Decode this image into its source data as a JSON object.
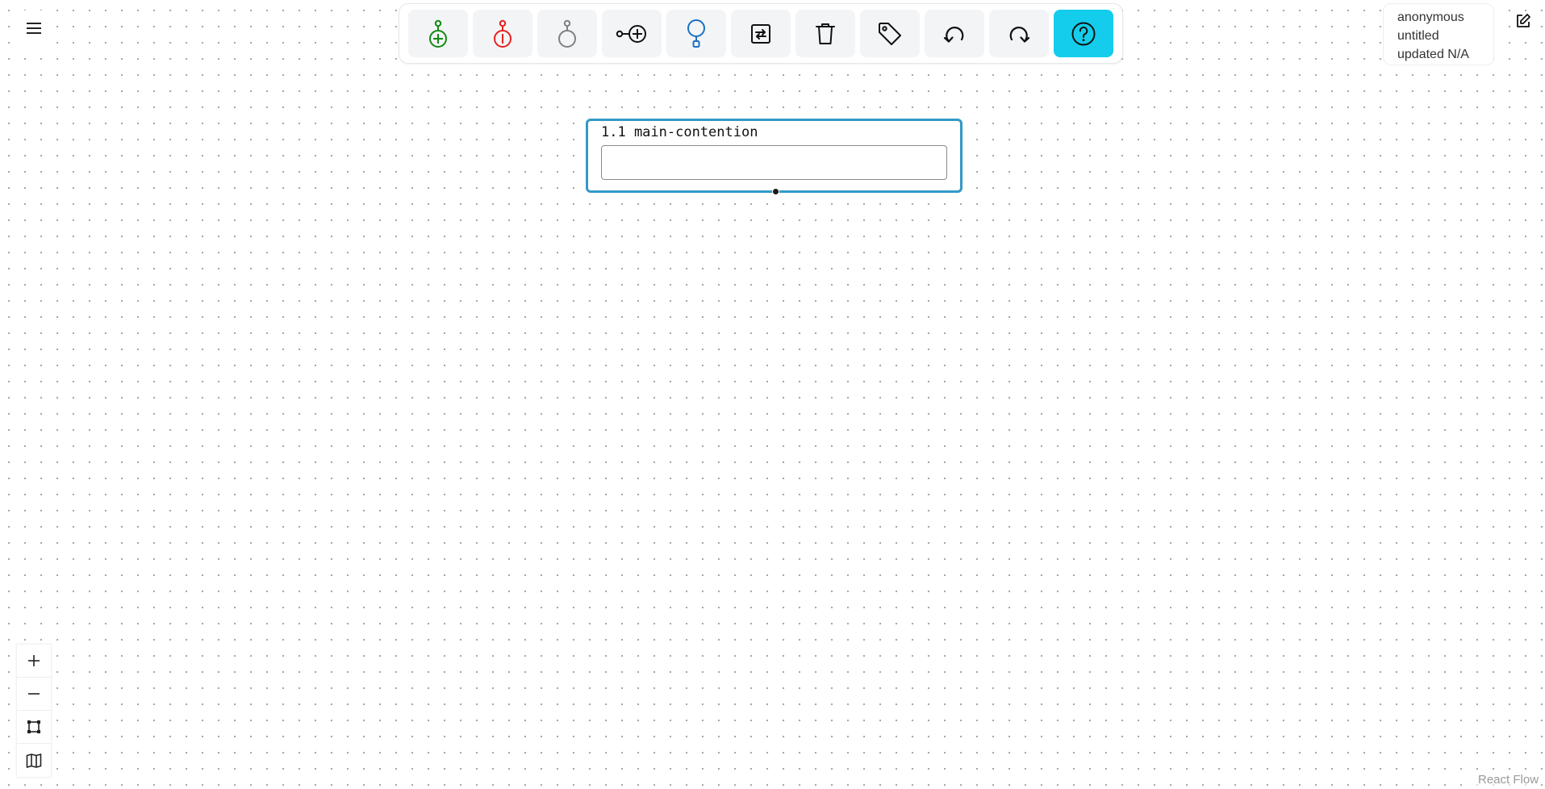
{
  "app": {
    "menu_icon": "hamburger-menu-icon",
    "attribution": "React Flow"
  },
  "toolbar": {
    "buttons": [
      {
        "icon": "add-support-icon",
        "color": "#138a13"
      },
      {
        "icon": "add-objection-icon",
        "color": "#e8201f"
      },
      {
        "icon": "add-neutral-icon",
        "color": "#808080"
      },
      {
        "icon": "add-connected-node-icon",
        "color": "#111111"
      },
      {
        "icon": "add-child-icon",
        "color": "#1b70c2"
      },
      {
        "icon": "swap-icon",
        "color": "#111111"
      },
      {
        "icon": "trash-icon",
        "color": "#111111"
      },
      {
        "icon": "tag-icon",
        "color": "#111111"
      },
      {
        "icon": "undo-icon",
        "color": "#111111"
      },
      {
        "icon": "redo-icon",
        "color": "#111111"
      },
      {
        "icon": "help-icon",
        "color": "#14cdec"
      }
    ]
  },
  "user_info": {
    "user": "anonymous",
    "document": "untitled",
    "updated": "updated N/A"
  },
  "edit_icon": "pencil-square-icon",
  "node": {
    "title": "1.1 main-contention",
    "input_value": "",
    "border_color": "#3399c7"
  },
  "controls": {
    "zoom_in_icon": "plus-icon",
    "zoom_out_icon": "minus-icon",
    "fit_view_icon": "fit-view-icon",
    "minimap_icon": "map-icon"
  }
}
